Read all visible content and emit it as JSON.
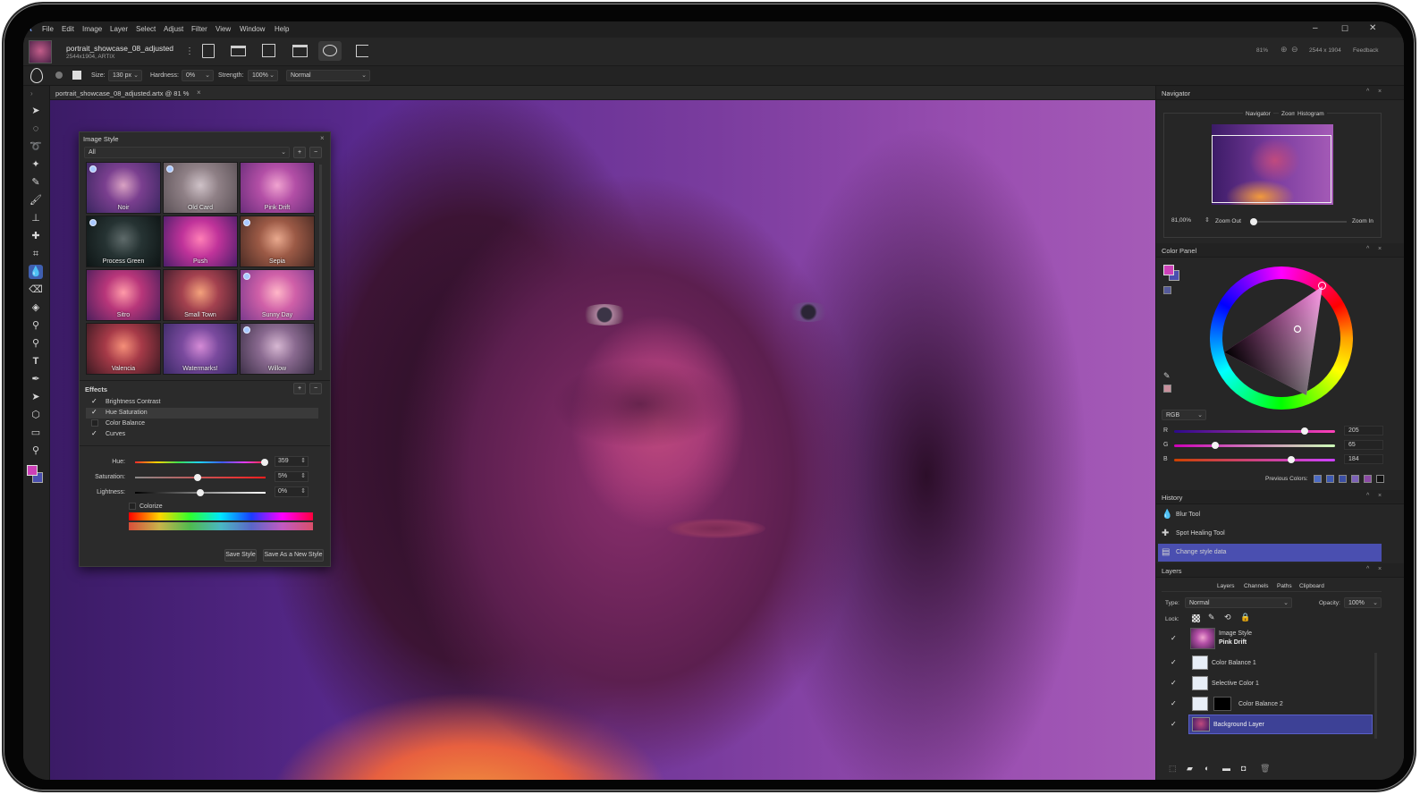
{
  "menu": {
    "logo": "A",
    "items": [
      "File",
      "Edit",
      "Image",
      "Layer",
      "Select",
      "Adjust",
      "Filter",
      "View",
      "Window",
      "Help"
    ]
  },
  "document": {
    "name": "portrait_showcase_08_adjusted",
    "info": "2544x1904, ARTIX",
    "tab": "portrait_showcase_08_adjusted.artx @ 81 %"
  },
  "status": {
    "zoom": "81%",
    "dims": "2544 x 1904",
    "feedback": "Feedback"
  },
  "options": {
    "size_label": "Size:",
    "size": "130 px",
    "hardness_label": "Hardness:",
    "hardness": "0%",
    "strength_label": "Strength:",
    "strength": "100%",
    "blend": "Normal"
  },
  "style_panel": {
    "title": "Image Style",
    "filter": "All",
    "styles": [
      {
        "name": "Noir",
        "dot": true
      },
      {
        "name": "Old Card",
        "dot": true
      },
      {
        "name": "Pink Drift",
        "dot": false
      },
      {
        "name": "Process Green",
        "dot": true
      },
      {
        "name": "Push",
        "dot": false
      },
      {
        "name": "Sepia",
        "dot": true
      },
      {
        "name": "Sitro",
        "dot": false
      },
      {
        "name": "Small Town",
        "dot": false
      },
      {
        "name": "Sunny Day",
        "dot": true
      },
      {
        "name": "Valencia",
        "dot": false
      },
      {
        "name": "Watermarks!",
        "dot": false
      },
      {
        "name": "Willow",
        "dot": true
      }
    ],
    "effects_title": "Effects",
    "effects": [
      {
        "name": "Brightness Contrast",
        "checked": true,
        "selected": false
      },
      {
        "name": "Hue Saturation",
        "checked": true,
        "selected": true
      },
      {
        "name": "Color Balance",
        "checked": false,
        "selected": false
      },
      {
        "name": "Curves",
        "checked": true,
        "selected": false
      }
    ],
    "hue_label": "Hue:",
    "hue_value": "359",
    "hue_fraction": 0.99,
    "saturation_label": "Saturation:",
    "saturation_value": "5%",
    "saturation_fraction": 0.48,
    "lightness_label": "Lightness:",
    "lightness_value": "0%",
    "lightness_fraction": 0.5,
    "colorize_label": "Colorize",
    "save_style": "Save Style",
    "save_new": "Save As a New Style"
  },
  "navigator": {
    "title": "Navigator",
    "tabs": [
      "Navigator",
      "Zoom",
      "Histogram"
    ],
    "zoom": "81,00%",
    "zoom_out": "Zoom Out",
    "zoom_in": "Zoom In"
  },
  "color_panel": {
    "title": "Color Panel",
    "mode": "RGB",
    "r_label": "R",
    "g_label": "G",
    "b_label": "B",
    "r": "205",
    "g": "65",
    "b": "184",
    "previous_colors_label": "Previous Colors:",
    "previous_colors": [
      "#4d6cc4",
      "#3d59b2",
      "#3c4fa3",
      "#7d62b8",
      "#8c4aa5",
      "#111111"
    ],
    "foreground": "#cd41b8",
    "background": "#4a4fb0"
  },
  "history": {
    "title": "History",
    "items": [
      {
        "name": "Blur Tool",
        "selected": false
      },
      {
        "name": "Spot Healing Tool",
        "selected": false
      },
      {
        "name": "Change style data",
        "selected": true
      }
    ]
  },
  "layers": {
    "title": "Layers",
    "tabs": [
      "Layers",
      "Channels",
      "Paths",
      "Clipboard"
    ],
    "type_label": "Type:",
    "type": "Normal",
    "opacity_label": "Opacity:",
    "opacity": "100%",
    "lock_label": "Lock:",
    "items": [
      {
        "name": "Image Style",
        "sub": "Pink Drift"
      },
      {
        "name": "Color Balance  1"
      },
      {
        "name": "Selective Color  1"
      },
      {
        "name": "Color Balance  2"
      },
      {
        "name": "Background Layer",
        "selected": true
      }
    ]
  },
  "colors": {
    "accent": "#4a4fb0",
    "selected_row": "#3d4196"
  }
}
